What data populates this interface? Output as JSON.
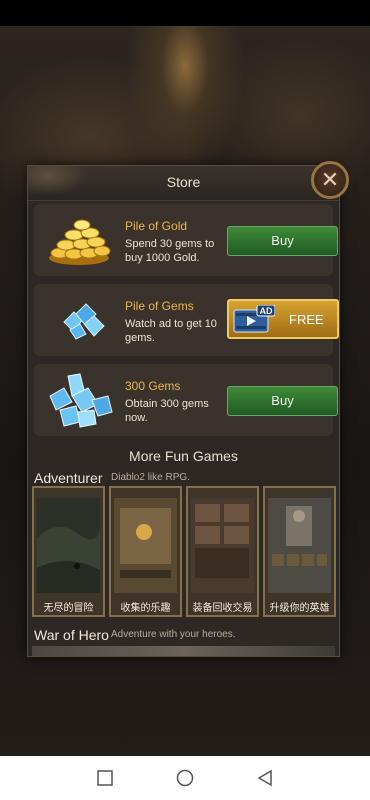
{
  "store": {
    "title": "Store",
    "items": [
      {
        "name": "Pile of Gold",
        "description": "Spend 30 gems to buy 1000 Gold.",
        "button": "Buy"
      },
      {
        "name": "Pile of Gems",
        "description": "Watch ad to get 10 gems.",
        "button": "FREE",
        "badge": "AD"
      },
      {
        "name": "300 Gems",
        "description": "Obtain 300 gems now.",
        "button": "Buy"
      }
    ]
  },
  "more_games": {
    "title": "More Fun Games",
    "games": [
      {
        "name": "Adventurer",
        "tagline": "Diablo2 like RPG.",
        "screens": [
          "无尽的冒险",
          "收集的乐趣",
          "装备回收交易",
          "升级你的英雄"
        ]
      },
      {
        "name": "War of Hero",
        "tagline": "Adventure with your heroes."
      }
    ]
  },
  "colors": {
    "gold_text": "#f0b34a",
    "buy_green": "#2f7a30",
    "free_gold": "#d7a332"
  },
  "icons": [
    "close-icon",
    "gold-coins-icon",
    "gems-icon",
    "gem-cluster-icon",
    "video-ad-icon",
    "square-icon",
    "circle-icon",
    "triangle-icon"
  ]
}
